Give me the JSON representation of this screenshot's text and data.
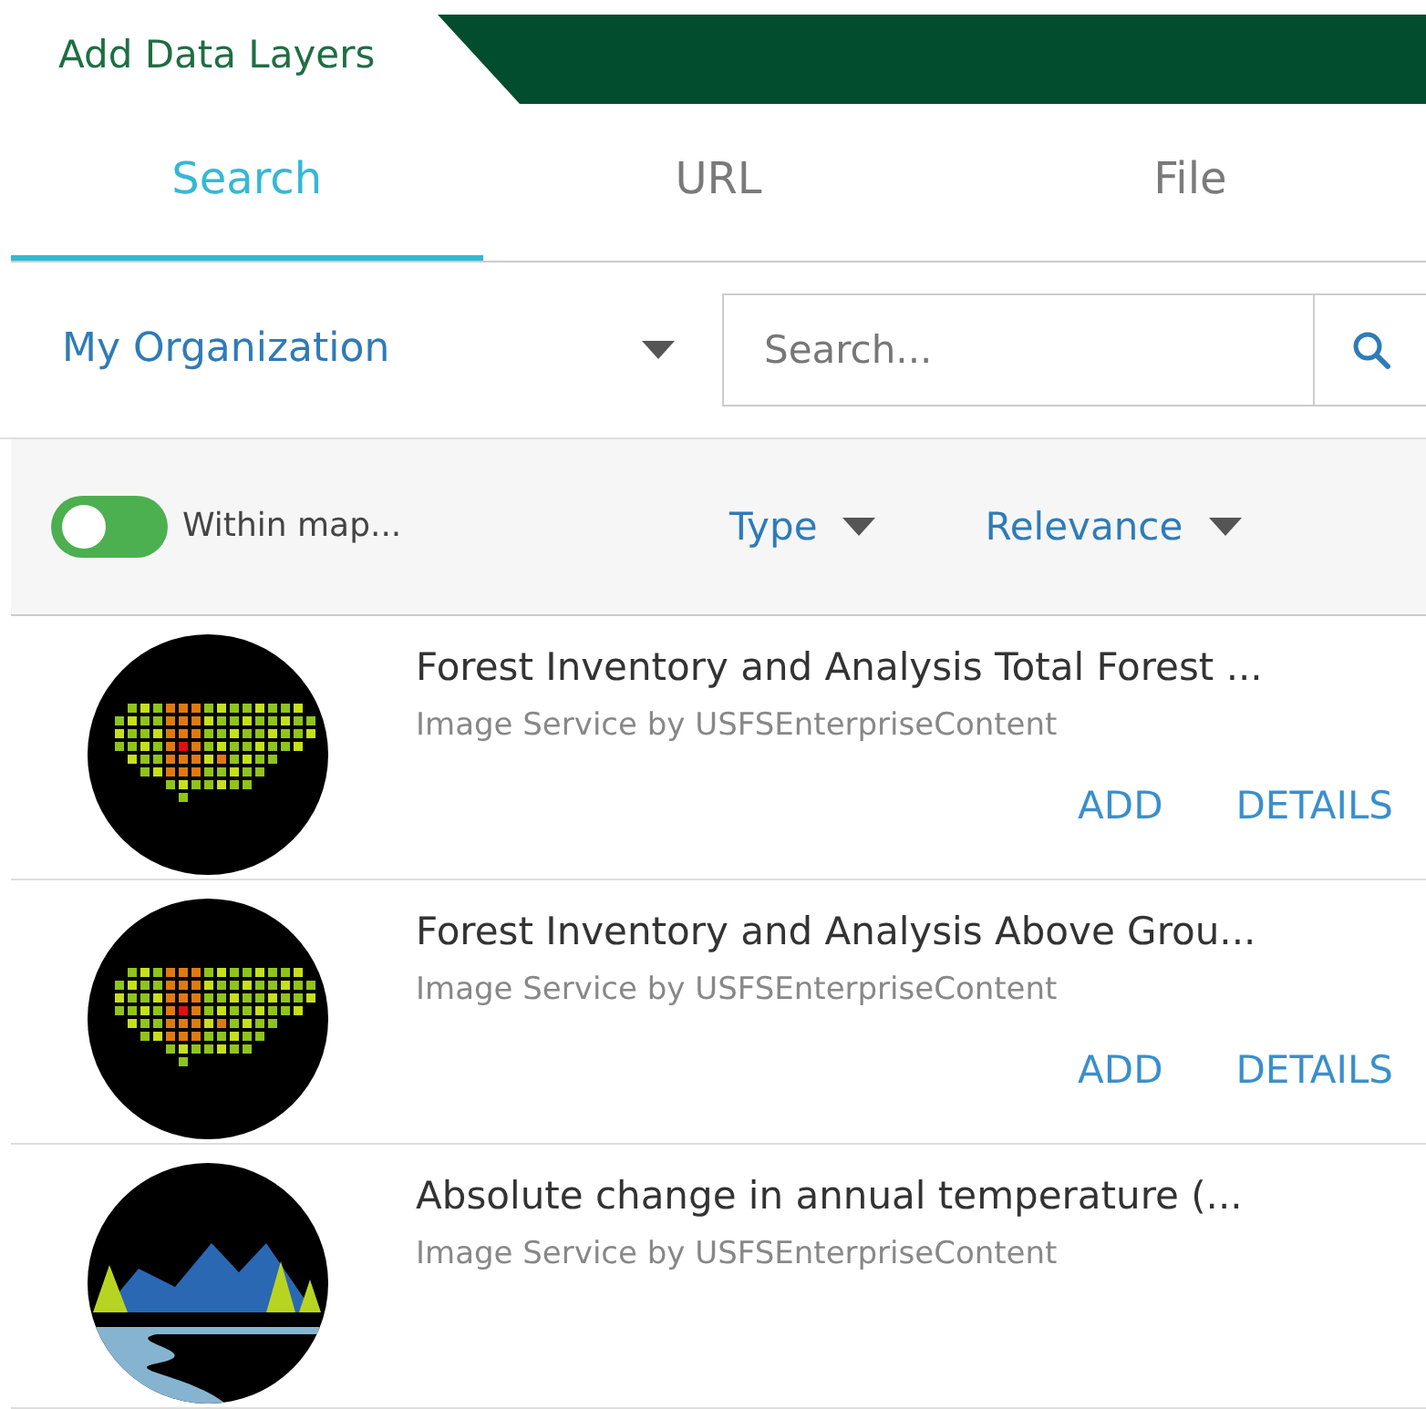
{
  "panel": {
    "title": "Add Data Layers"
  },
  "tabs": [
    {
      "label": "Search",
      "selected": true
    },
    {
      "label": "URL",
      "selected": false
    },
    {
      "label": "File",
      "selected": false
    }
  ],
  "scope": {
    "label": "My Organization"
  },
  "search": {
    "placeholder": "Search..."
  },
  "filters": {
    "toggle": {
      "label": "Within map...",
      "on": false
    },
    "type": "Type",
    "sort": "Relevance"
  },
  "results": [
    {
      "title": "Forest Inventory and Analysis Total Forest ...",
      "subtitle": "Image Service by USFSEnterpriseContent",
      "kind": "grid-map",
      "actions": [
        "ADD",
        "DETAILS"
      ]
    },
    {
      "title": "Forest Inventory and Analysis Above Grou...",
      "subtitle": "Image Service by USFSEnterpriseContent",
      "kind": "grid-map",
      "actions": [
        "ADD",
        "DETAILS"
      ]
    },
    {
      "title": "Absolute change in annual temperature (...",
      "subtitle": "Image Service by USFSEnterpriseContent",
      "kind": "landscape"
    }
  ]
}
